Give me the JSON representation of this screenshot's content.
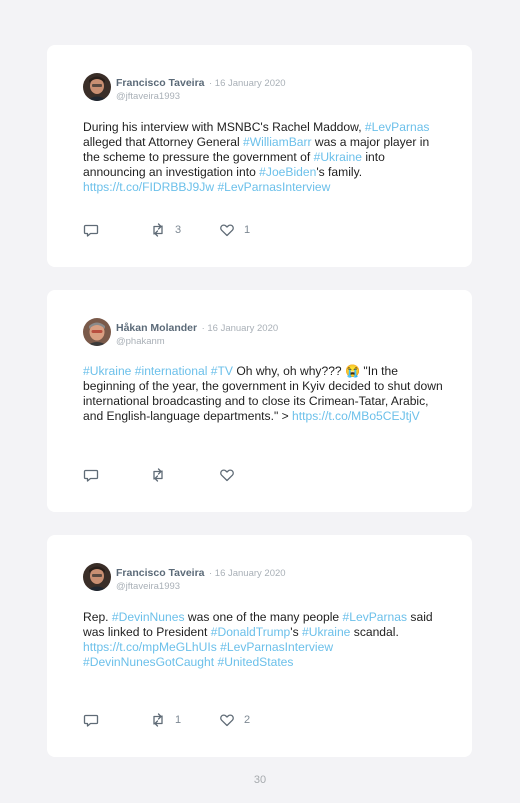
{
  "tweets": [
    {
      "author": "Francisco Taveira",
      "date": "· 16 January 2020",
      "handle": "@jftaveira1993",
      "text": [
        {
          "t": "During his interview with MSNBC's Rachel Maddow, "
        },
        {
          "t": "#LevParnas",
          "link": true
        },
        {
          "t": " alleged that Attorney General "
        },
        {
          "t": "#WilliamBarr",
          "link": true
        },
        {
          "t": " was a major player in the scheme to pressure the government of "
        },
        {
          "t": "#Ukraine",
          "link": true
        },
        {
          "t": " into announcing an investigation into "
        },
        {
          "t": "#JoeBiden",
          "link": true
        },
        {
          "t": "'s family. "
        },
        {
          "t": "https://t.co/FIDRBBJ9Jw",
          "link": true
        },
        {
          "t": " "
        },
        {
          "t": "#LevParnasInterview",
          "link": true
        }
      ],
      "retweets": "3",
      "likes": "1"
    },
    {
      "author": "Håkan Molander",
      "date": "· 16 January 2020",
      "handle": "@phakanm",
      "text": [
        {
          "t": "#Ukraine",
          "link": true
        },
        {
          "t": " "
        },
        {
          "t": "#international",
          "link": true
        },
        {
          "t": " "
        },
        {
          "t": "#TV",
          "link": true
        },
        {
          "t": " Oh why, oh why??? 😭 \"In the beginning of the year, the government in Kyiv decided to shut down international broadcasting and to close its Crimean-Tatar, Arabic, and English-language departments.\" > "
        },
        {
          "t": "https://t.co/MBo5CEJtjV",
          "link": true
        }
      ],
      "retweets": "",
      "likes": ""
    },
    {
      "author": "Francisco Taveira",
      "date": "· 16 January 2020",
      "handle": "@jftaveira1993",
      "text": [
        {
          "t": "Rep. "
        },
        {
          "t": "#DevinNunes",
          "link": true
        },
        {
          "t": " was one of the many people "
        },
        {
          "t": "#LevParnas",
          "link": true
        },
        {
          "t": " said was linked to President "
        },
        {
          "t": "#DonaldTrump",
          "link": true
        },
        {
          "t": "'s "
        },
        {
          "t": "#Ukraine",
          "link": true
        },
        {
          "t": " scandal. "
        },
        {
          "t": "https://t.co/mpMeGLhUIs",
          "link": true
        },
        {
          "t": " "
        },
        {
          "t": "#LevParnasInterview",
          "link": true
        },
        {
          "t": " "
        },
        {
          "t": "#DevinNunesGotCaught",
          "link": true
        },
        {
          "t": " "
        },
        {
          "t": "#UnitedStates",
          "link": true
        }
      ],
      "retweets": "1",
      "likes": "2"
    }
  ],
  "page_number": "30",
  "colors": {
    "link": "#6cc0ea",
    "name": "#5b6a78",
    "muted": "#a9b0b7"
  }
}
